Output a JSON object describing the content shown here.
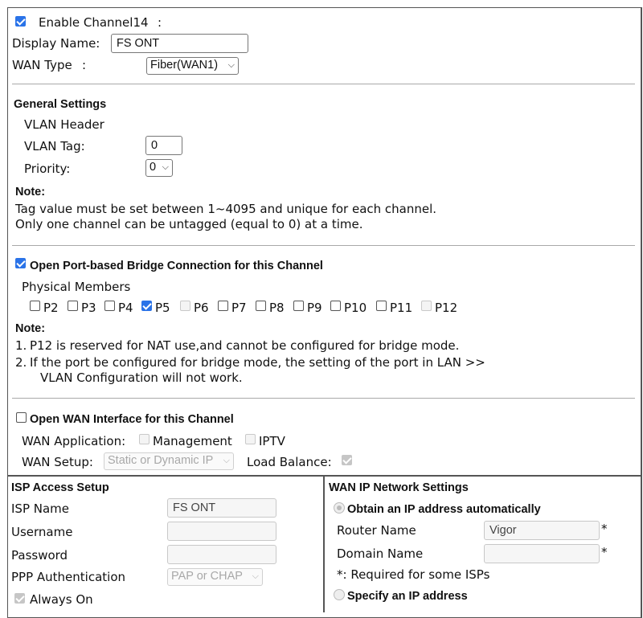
{
  "channel": {
    "enable_label": "Enable Channel14",
    "enable_colon": ":",
    "enabled": true
  },
  "display_name": {
    "label": "Display Name:",
    "value": "FS ONT"
  },
  "wan_type": {
    "label": "WAN Type",
    "colon": ":",
    "value": "Fiber(WAN1)"
  },
  "general": {
    "heading": "General Settings",
    "vlan_header": "VLAN Header",
    "vlan_tag_label": "VLAN Tag:",
    "vlan_tag_value": "0",
    "priority_label": "Priority:",
    "priority_value": "0",
    "note_title": "Note:",
    "note_line1": "Tag value must be set between 1~4095 and unique for each channel.",
    "note_line2": "Only one channel can be untagged (equal to 0) at a time."
  },
  "bridge": {
    "checked": true,
    "heading": "Open Port-based Bridge Connection for this Channel",
    "members_label": "Physical Members",
    "ports": [
      {
        "label": "P2",
        "checked": false,
        "disabled": false
      },
      {
        "label": "P3",
        "checked": false,
        "disabled": false
      },
      {
        "label": "P4",
        "checked": false,
        "disabled": false
      },
      {
        "label": "P5",
        "checked": true,
        "disabled": false
      },
      {
        "label": "P6",
        "checked": false,
        "disabled": true
      },
      {
        "label": "P7",
        "checked": false,
        "disabled": false
      },
      {
        "label": "P8",
        "checked": false,
        "disabled": false
      },
      {
        "label": "P9",
        "checked": false,
        "disabled": false
      },
      {
        "label": "P10",
        "checked": false,
        "disabled": false
      },
      {
        "label": "P11",
        "checked": false,
        "disabled": false
      },
      {
        "label": "P12",
        "checked": false,
        "disabled": true
      }
    ],
    "note_title": "Note:",
    "note1_num": "1.",
    "note1": "P12 is reserved for NAT use,and cannot be configured for bridge mode.",
    "note2_num": "2.",
    "note2a": "If the port be configured for bridge mode, the setting of the port in LAN >>",
    "note2b": "VLAN Configuration will not work."
  },
  "wan_iface": {
    "checked": false,
    "heading": "Open WAN Interface for this Channel",
    "app_label": "WAN Application:",
    "app_management": "Management",
    "app_iptv": "IPTV",
    "setup_label": "WAN Setup:",
    "setup_value": "Static or Dynamic IP",
    "load_balance_label": "Load Balance:",
    "load_balance_checked": true
  },
  "isp": {
    "heading": "ISP Access Setup",
    "isp_name_label": "ISP Name",
    "isp_name_value": "FS ONT",
    "username_label": "Username",
    "username_value": "",
    "password_label": "Password",
    "password_value": "",
    "ppp_auth_label": "PPP Authentication",
    "ppp_auth_value": "PAP or CHAP",
    "always_on_label": "Always On",
    "always_on_checked": true
  },
  "wan_ip": {
    "heading": "WAN IP Network Settings",
    "obtain_label": "Obtain an IP address automatically",
    "router_name_label": "Router Name",
    "router_name_value": "Vigor",
    "star": "*",
    "domain_name_label": "Domain Name",
    "domain_name_value": "",
    "required_note": "*: Required for some ISPs",
    "specify_label": "Specify an IP address"
  }
}
